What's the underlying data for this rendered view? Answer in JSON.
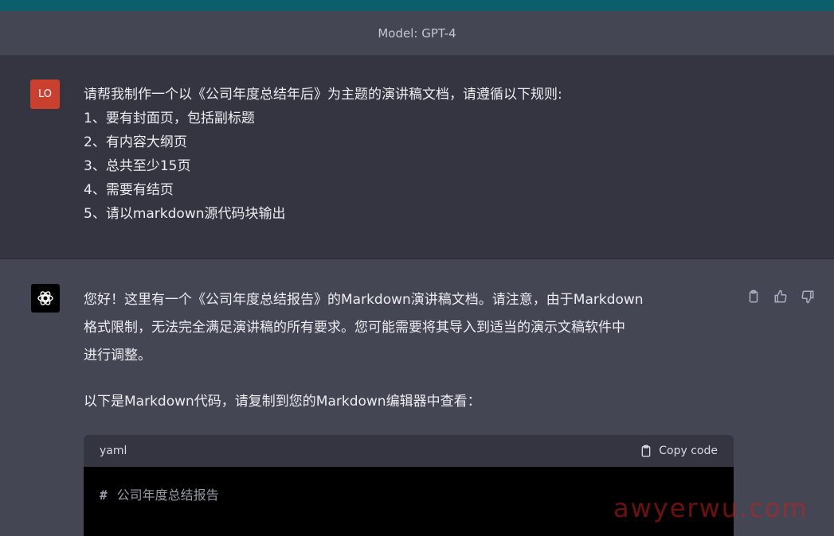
{
  "header": {
    "model_label": "Model: GPT-4"
  },
  "user": {
    "avatar_label": "LO",
    "lines": [
      "请帮我制作一个以《公司年度总结年后》为主题的演讲稿文档，请遵循以下规则:",
      "1、要有封面页，包括副标题",
      "2、有内容大纲页",
      "3、总共至少15页",
      "4、需要有结页",
      "5、请以markdown源代码块输出"
    ]
  },
  "assistant": {
    "paragraph1_lines": [
      "您好！这里有一个《公司年度总结报告》的Markdown演讲稿文档。请注意，由于Markdown",
      "格式限制，无法完全满足演讲稿的所有要求。您可能需要将其导入到适当的演示文稿软件中",
      "进行调整。"
    ],
    "paragraph2": "以下是Markdown代码，请复制到您的Markdown编辑器中查看：",
    "code": {
      "language": "yaml",
      "copy_label": "Copy code",
      "first_line": "公司年度总结报告",
      "first_line_prefix": "#"
    }
  },
  "watermark": "awyerwu.com"
}
